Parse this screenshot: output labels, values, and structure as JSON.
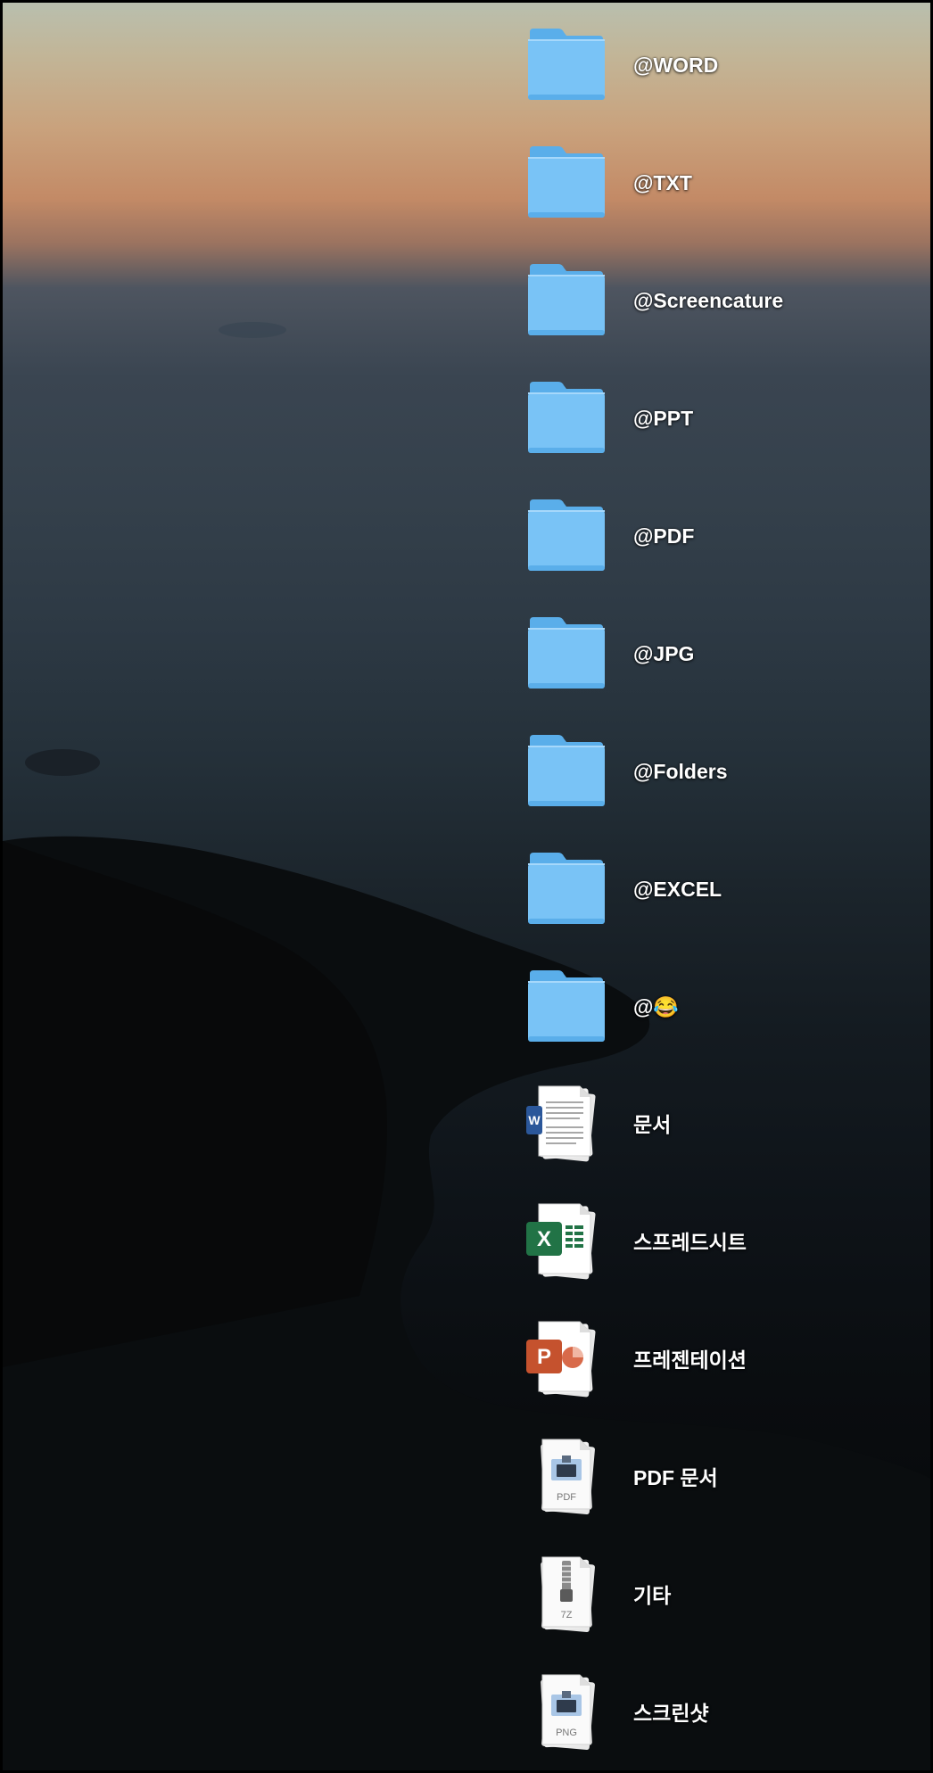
{
  "desktop": {
    "items": [
      {
        "label": "@WORD",
        "icon": "folder-icon",
        "kind": "folder"
      },
      {
        "label": "@TXT",
        "icon": "folder-icon",
        "kind": "folder"
      },
      {
        "label": "@Screencature",
        "icon": "folder-icon",
        "kind": "folder"
      },
      {
        "label": "@PPT",
        "icon": "folder-icon",
        "kind": "folder"
      },
      {
        "label": "@PDF",
        "icon": "folder-icon",
        "kind": "folder"
      },
      {
        "label": "@JPG",
        "icon": "folder-icon",
        "kind": "folder"
      },
      {
        "label": "@Folders",
        "icon": "folder-icon",
        "kind": "folder"
      },
      {
        "label": "@EXCEL",
        "icon": "folder-icon",
        "kind": "folder"
      },
      {
        "label": "@😂",
        "icon": "folder-icon",
        "kind": "folder"
      },
      {
        "label": "문서",
        "icon": "word-document-stack-icon",
        "kind": "stack"
      },
      {
        "label": "스프레드시트",
        "icon": "excel-spreadsheet-stack-icon",
        "kind": "stack"
      },
      {
        "label": "프레젠테이션",
        "icon": "powerpoint-presentation-stack-icon",
        "kind": "stack"
      },
      {
        "label": "PDF 문서",
        "icon": "pdf-document-stack-icon",
        "kind": "stack",
        "badge": "PDF"
      },
      {
        "label": "기타",
        "icon": "archive-7z-stack-icon",
        "kind": "stack",
        "badge": "7Z"
      },
      {
        "label": "스크린샷",
        "icon": "png-screenshot-stack-icon",
        "kind": "stack",
        "badge": "PNG"
      }
    ]
  },
  "colors": {
    "folder_body": "#79c3f6",
    "folder_tab": "#5aaeea",
    "word_blue": "#2b579a",
    "excel_green": "#217346",
    "ppt_red": "#c5522e"
  }
}
